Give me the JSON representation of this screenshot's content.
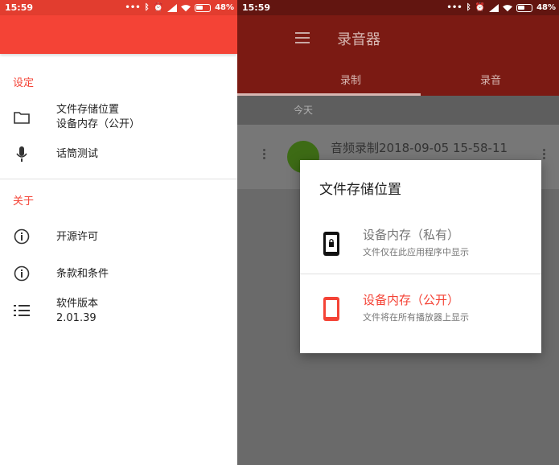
{
  "left": {
    "status": {
      "time": "15:59",
      "battery": "48%"
    },
    "settings_header": "设定",
    "storage_location": {
      "label": "文件存储位置",
      "value": "设备内存（公开）"
    },
    "mic_test": "话筒测试",
    "about_header": "关于",
    "open_source": "开源许可",
    "terms": "条款和条件",
    "version": {
      "label": "软件版本",
      "value": "2.01.39"
    }
  },
  "right": {
    "status": {
      "time": "15:59",
      "battery": "48%"
    },
    "app_title": "录音器",
    "tabs": [
      {
        "label": "录制"
      },
      {
        "label": "录音"
      }
    ],
    "date_header": "今天",
    "recording_title": "音频录制2018-09-05 15-58-11",
    "dialog": {
      "title": "文件存储位置",
      "options": [
        {
          "name": "设备内存（私有）",
          "desc": "文件仅在此应用程序中显示"
        },
        {
          "name": "设备内存（公开）",
          "desc": "文件将在所有播放器上显示"
        }
      ]
    }
  },
  "colors": {
    "accent": "#f44336",
    "accent_dark": "#e23d2f",
    "selected": "#f44336"
  }
}
